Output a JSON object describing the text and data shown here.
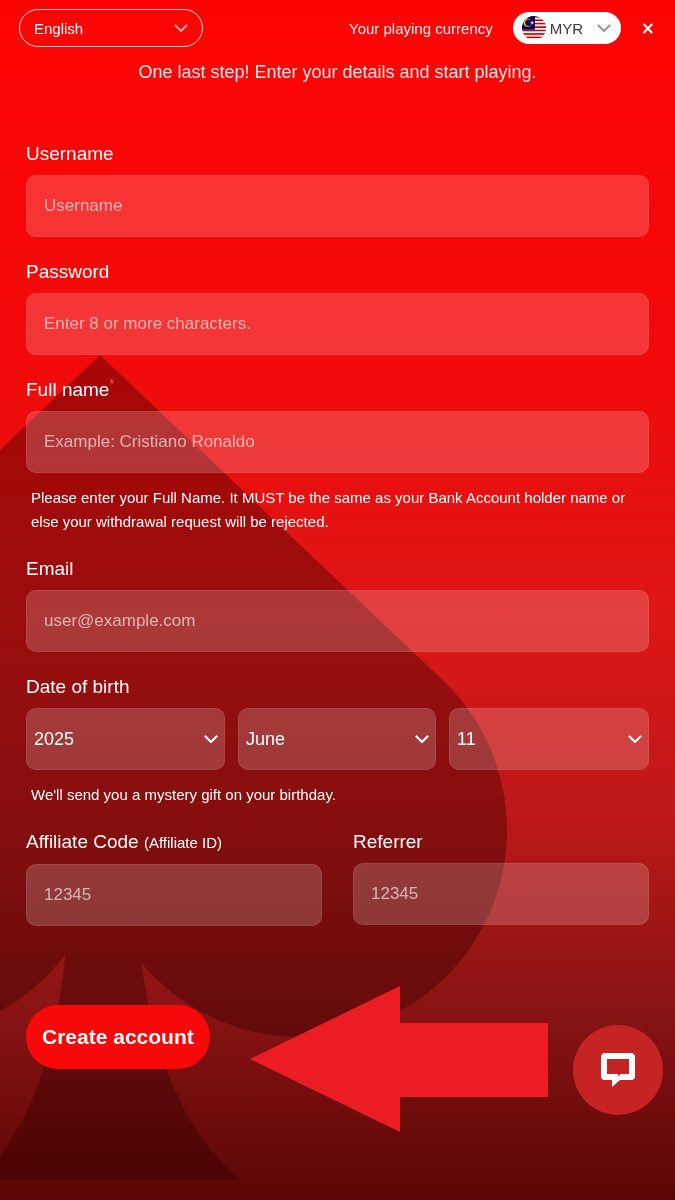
{
  "top_bar": {
    "language": {
      "value": "English"
    },
    "currency_label": "Your playing currency",
    "currency": {
      "value": "MYR"
    },
    "close": "×"
  },
  "intro": "One last step! Enter your details and start playing.",
  "fields": [
    {
      "kind": "input",
      "label": "Username",
      "placeholder": "Username"
    },
    {
      "kind": "input",
      "label": "Password",
      "placeholder": "Enter 8 or more characters."
    },
    {
      "kind": "input",
      "label": "Full name",
      "required_mark": "*",
      "placeholder": "Example: Cristiano Ronaldo",
      "note": "Please enter your Full Name. It MUST be the same as your Bank Account holder name or else your withdrawal request will be rejected."
    },
    {
      "kind": "input",
      "label": "Email",
      "placeholder": "user@example.com"
    },
    {
      "kind": "date",
      "label": "Date of birth",
      "selects": [
        {
          "value": "2025"
        },
        {
          "value": "June"
        },
        {
          "value": "11"
        }
      ],
      "note": "We'll send you a mystery gift on your birthday."
    },
    {
      "kind": "pair",
      "columns": [
        {
          "label": "Affiliate Code",
          "label_note": "(Affiliate ID)",
          "placeholder": "12345"
        },
        {
          "label": "Referrer",
          "placeholder": "12345"
        }
      ]
    }
  ],
  "submit": {
    "label": "Create account"
  }
}
